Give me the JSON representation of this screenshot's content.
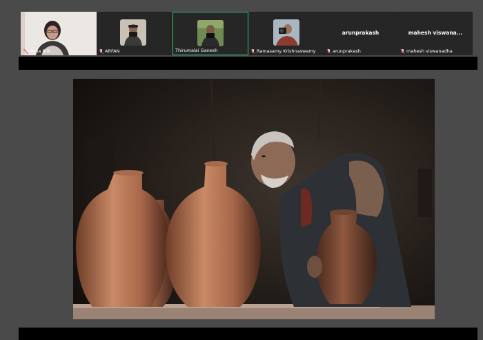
{
  "participants": [
    {
      "name": "Reha Bilir",
      "muted": true
    },
    {
      "name": "ARFAN",
      "muted": true
    },
    {
      "name": "Thirumalai Ganesh",
      "muted": false,
      "speaking": true
    },
    {
      "name": "Ramasamy Krishnaswamy",
      "muted": true
    },
    {
      "name": "arunprakash",
      "display_name": "arunprakash",
      "muted": true
    },
    {
      "name": "mahesh viswanadha",
      "display_name": "mahesh  viswana...",
      "muted": true
    }
  ],
  "colors": {
    "speaking_border": "#2cc56f",
    "muted_mic": "#e23a3a",
    "background": "#4a4a4a"
  }
}
